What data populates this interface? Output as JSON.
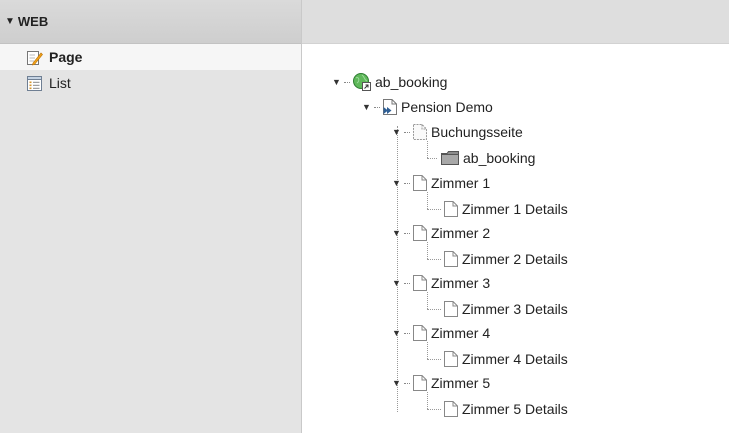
{
  "module_menu": {
    "section_label": "WEB",
    "items": [
      {
        "label": "Page",
        "icon": "page-module-icon",
        "active": true
      },
      {
        "label": "List",
        "icon": "list-module-icon",
        "active": false
      }
    ]
  },
  "tree": {
    "root": {
      "label": "ab_booking",
      "icon": "globe-icon"
    },
    "pension": {
      "label": "Pension Demo",
      "icon": "shortcut-page-icon"
    },
    "booking_page": {
      "label": "Buchungsseite",
      "icon": "hidden-page-icon"
    },
    "booking_folder": {
      "label": "ab_booking",
      "icon": "folder-icon"
    },
    "rooms": [
      {
        "label": "Zimmer 1",
        "detail": "Zimmer 1 Details"
      },
      {
        "label": "Zimmer 2",
        "detail": "Zimmer 2 Details"
      },
      {
        "label": "Zimmer 3",
        "detail": "Zimmer 3 Details"
      },
      {
        "label": "Zimmer 4",
        "detail": "Zimmer 4 Details"
      },
      {
        "label": "Zimmer 5",
        "detail": "Zimmer 5 Details"
      }
    ]
  },
  "colors": {
    "sidebar_bg": "#e4e4e4",
    "active_item_bg": "#f6f6f6",
    "globe": "#4caf50"
  }
}
